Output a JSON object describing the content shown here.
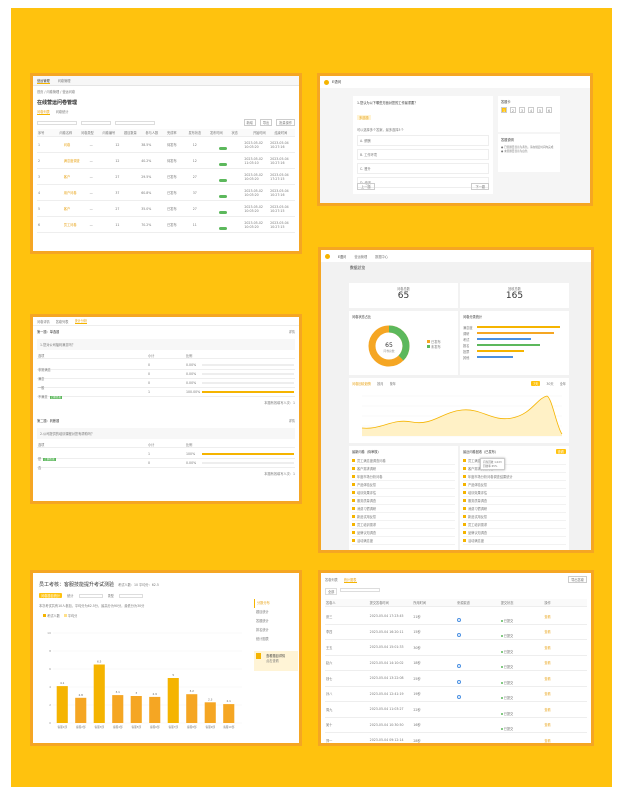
{
  "colors": {
    "background": "#FFC20E",
    "frame": "#F5A623",
    "accent": "#F5B400",
    "blue": "#4A90E2",
    "green": "#5CB85C"
  },
  "p1": {
    "tabs": [
      "营运管理",
      "问卷管理"
    ],
    "breadcrumb": "首页 / 问卷管理 / 营运问卷",
    "title": "在线营运问卷管理",
    "subtabs": [
      "问卷列表",
      "问卷统计"
    ],
    "actions": [
      "新增",
      "导出",
      "批量操作"
    ],
    "headers": [
      "序号",
      "问卷名称",
      "问卷类型",
      "问卷编号",
      "题目数量",
      "参与人数",
      "完成率",
      "发布状态",
      "发布时间",
      "状态",
      "开始时间",
      "结束时间"
    ],
    "rows": [
      {
        "name": "问卷",
        "n": "12",
        "pct": "38.5%",
        "st": "待发布",
        "t1": "2023-05-02 10:03:20",
        "t2": "2023-05-04 10:27:16"
      },
      {
        "name": "满意度调查",
        "n": "12",
        "pct": "40.2%",
        "st": "待发布",
        "t1": "2023-05-02 11:03:10",
        "t2": "2023-05-04 10:27:16"
      },
      {
        "name": "客户",
        "n": "27",
        "pct": "29.5%",
        "st": "已发布",
        "t1": "2023-05-02 10:03:20",
        "t2": "2023-05-04 17:27:15"
      },
      {
        "name": "用户问卷",
        "n": "37",
        "pct": "60.8%",
        "st": "已发布",
        "t1": "2023-05-02 10:03:20",
        "t2": "2023-05-04 10:27:16"
      },
      {
        "name": "客户",
        "n": "27",
        "pct": "35.0%",
        "st": "已发布",
        "t1": "2023-05-02 10:03:20",
        "t2": "2023-05-04 10:27:15"
      },
      {
        "name": "员工问卷",
        "n": "11",
        "pct": "70.2%",
        "st": "已发布",
        "t1": "2023-05-02 10:03:20",
        "t2": "2023-05-04 10:27:15"
      }
    ]
  },
  "p2": {
    "logo": "E语问",
    "question": "1.您认为以下哪些方面对您的工作最重要？",
    "tag": "多选题",
    "hint": "可以选择多个答案，最多选择3个",
    "options": [
      "A. 薪酬",
      "B. 工作环境",
      "C. 晋升",
      "D. 培训"
    ],
    "nav_title": "答题卡",
    "nav_nums": [
      "1",
      "2",
      "3",
      "4",
      "5",
      "6"
    ],
    "tips_title": "答题说明",
    "tips": [
      "● 已答题目显示为黄色，请在规定时间内完成",
      "● 未答题目显示为白色"
    ],
    "footer": [
      "上一题",
      "下一题"
    ]
  },
  "p3": {
    "logo": "E语问",
    "nav": [
      "营运管理",
      "数据中心"
    ],
    "title": "数据总览",
    "stat1_label": "问卷总数",
    "stat1": "65",
    "stat2_label": "回收总数",
    "stat2": "165",
    "donut_title": "问卷状态占比",
    "donut_center": "65",
    "donut_sub": "问卷总数",
    "donut_legend": [
      "已发布",
      "未发布"
    ],
    "bars_title": "问卷分类统计",
    "bar_labels": [
      "满意度",
      "调研",
      "考试",
      "报名",
      "投票",
      "其他"
    ],
    "line_tabs": [
      "问卷回收趋势",
      "按月",
      "按年"
    ],
    "line_btns": [
      "7天",
      "30天",
      "全年"
    ],
    "list1_title": "最新问卷（待审核）",
    "list2_title": "最近问卷回收（已发布）",
    "list_btn": "查看",
    "list1": [
      "员工满意度调查问卷",
      "客户需求调研",
      "年度市场分析问卷",
      "产品体验反馈",
      "培训效果评估",
      "服务质量调查",
      "消费习惯调研",
      "新品试用反馈",
      "员工培训需求",
      "品牌认知调查",
      "活动满意度"
    ],
    "list2": [
      "员工满意度调查问卷",
      "客户需求调研问卷",
      "年度市场分析问卷调查结果统计",
      "产品体验反馈",
      "培训效果评估",
      "服务质量调查",
      "消费习惯调研",
      "新品试用反馈",
      "员工培训需求",
      "品牌认知调查",
      "活动满意度"
    ],
    "tooltip": [
      "问卷回收 1,023",
      "回收率 65%"
    ]
  },
  "p4": {
    "tabs": [
      "问卷详情",
      "答卷列表",
      "统计分析"
    ],
    "q1": "第一题：单选题",
    "q1_sub": "1.您对公司福利满意吗？",
    "head": [
      "选项",
      "小计",
      "比例"
    ],
    "q1_opts": [
      {
        "label": "非常满意",
        "n": "0",
        "p": "0.00%"
      },
      {
        "label": "满意",
        "n": "0",
        "p": "0.00%"
      },
      {
        "label": "一般",
        "n": "0",
        "p": "0.00%"
      },
      {
        "label": "不满意",
        "n": "1",
        "p": "100.00%",
        "tag": "正确答案"
      }
    ],
    "total1": "本题有效填写人次：1",
    "q2": "第二题：判断题",
    "q2_sub": "2.公司提供的培训课程对您有帮助吗？",
    "q2_opts": [
      {
        "label": "是",
        "n": "1",
        "p": "100%",
        "tag": "正确答案"
      },
      {
        "label": "否",
        "n": "0",
        "p": "0.00%"
      }
    ],
    "total2": "本题有效填写人次：1",
    "detail": "详情"
  },
  "p5": {
    "title": "员工考核：客服技能提升考试测验",
    "meta": "考试人数：10  平均分：62.5",
    "filters": [
      "问卷题目统计",
      "统计",
      "类型"
    ],
    "summary": "本次考试共有10人参加，平均分为62.5分，最高分为90分，最低分为30分",
    "legend": [
      "考试人数",
      "平均分"
    ],
    "chart_data": {
      "type": "bar",
      "categories": [
        "客服1部",
        "客服2部",
        "客服3部",
        "客服4部",
        "客服5部",
        "客服6部",
        "客服7部",
        "客服8部",
        "客服9部",
        "客服10部"
      ],
      "values": [
        4.1,
        2.8,
        6.5,
        3.1,
        3.0,
        2.9,
        5.0,
        3.2,
        2.3,
        2.1
      ],
      "ylim": [
        0,
        10
      ]
    },
    "side_menu": [
      "分数分布",
      "题目统计",
      "答题统计",
      "排名统计",
      "统计图表"
    ],
    "side_card": "查看题目详情",
    "side_card_sub": "点击查看"
  },
  "p6": {
    "tabs": [
      "答卷列表",
      "统计图表"
    ],
    "filter": "全部",
    "export": "导出答卷",
    "headers": [
      "答卷人",
      "提交答卷时间",
      "所用时间",
      "来源渠道",
      "提交状态",
      "操作"
    ],
    "rows": [
      {
        "name": "张三",
        "time": "2023-05-04 17:23:45",
        "dur": "21秒",
        "status": "已提交",
        "op": "查看"
      },
      {
        "name": "李四",
        "time": "2023-05-04 16:20:11",
        "dur": "15秒",
        "status": "已提交",
        "op": "查看"
      },
      {
        "name": "王五",
        "time": "2023-05-04 15:01:33",
        "dur": "30秒",
        "status": "已提交",
        "op": "查看"
      },
      {
        "name": "赵六",
        "time": "2023-05-04 14:10:02",
        "dur": "18秒",
        "status": "已提交",
        "op": "查看"
      },
      {
        "name": "钱七",
        "time": "2023-05-04 13:22:08",
        "dur": "25秒",
        "status": "已提交",
        "op": "查看"
      },
      {
        "name": "孙八",
        "time": "2023-05-04 12:41:19",
        "dur": "19秒",
        "status": "已提交",
        "op": "查看"
      },
      {
        "name": "周九",
        "time": "2023-05-04 11:03:27",
        "dur": "22秒",
        "status": "已提交",
        "op": "查看"
      },
      {
        "name": "吴十",
        "time": "2023-05-04 10:30:50",
        "dur": "16秒",
        "status": "已提交",
        "op": "查看"
      },
      {
        "name": "郑一",
        "time": "2023-05-04 09:12:14",
        "dur": "28秒",
        "status": "已提交",
        "op": "查看"
      }
    ]
  }
}
